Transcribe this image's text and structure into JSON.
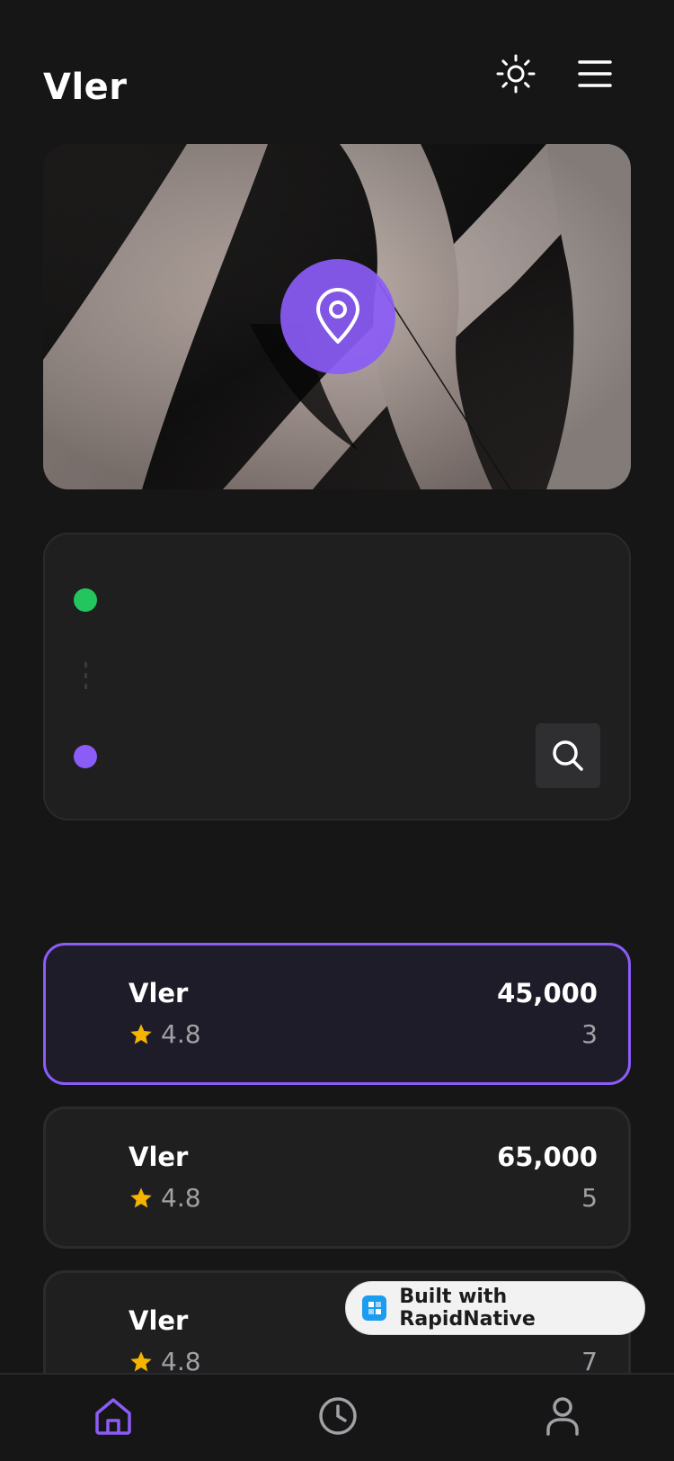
{
  "header": {
    "title": "Vler",
    "theme_toggle_icon": "sun-icon",
    "menu_icon": "hamburger-menu-icon"
  },
  "hero": {
    "image_description": "abstract beige architectural curves",
    "pin_icon": "map-pin-icon",
    "accent": "#8b5cf6"
  },
  "route": {
    "from_dot_color": "#22c55e",
    "to_dot_color": "#8b5cf6",
    "search_icon": "search-icon"
  },
  "rides": [
    {
      "name": "Vler",
      "rating": "4.8",
      "price": "45,000",
      "seats": "3",
      "selected": true
    },
    {
      "name": "Vler",
      "rating": "4.8",
      "price": "65,000",
      "seats": "5",
      "selected": false
    },
    {
      "name": "Vler",
      "rating": "4.8",
      "price": "",
      "seats": "7",
      "selected": false
    }
  ],
  "badge": {
    "label": "Built with RapidNative"
  },
  "bottom_nav": [
    {
      "name": "home",
      "icon": "home-icon",
      "active": true
    },
    {
      "name": "history",
      "icon": "clock-icon",
      "active": false
    },
    {
      "name": "profile",
      "icon": "user-icon",
      "active": false
    }
  ],
  "colors": {
    "background": "#161617",
    "card": "#1f1f20",
    "accent": "#8b5cf6",
    "star": "#f5b400"
  }
}
